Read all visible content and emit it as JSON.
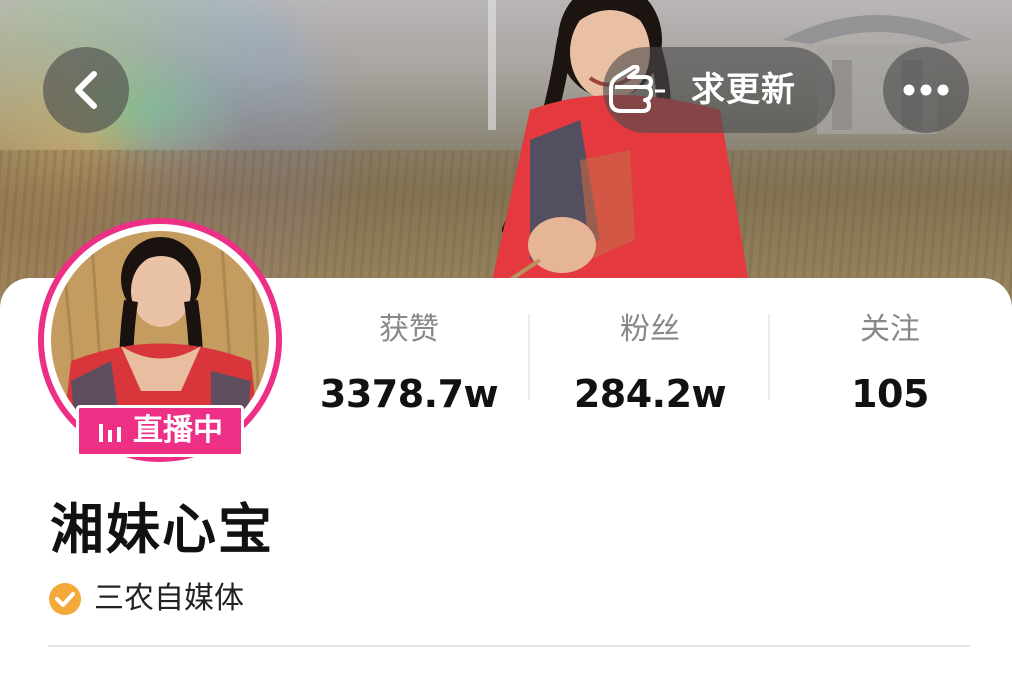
{
  "header": {
    "update_label": "求更新",
    "icons": [
      "chevron-left-icon",
      "pointing-hand-icon",
      "more-dots-icon"
    ]
  },
  "profile": {
    "live_label": "直播中",
    "name": "湘妹心宝",
    "verification": "三农自媒体"
  },
  "stats": [
    {
      "label": "获赞",
      "value": "3378.7w"
    },
    {
      "label": "粉丝",
      "value": "284.2w"
    },
    {
      "label": "关注",
      "value": "105"
    }
  ],
  "colors": {
    "accent_pink": "#ee2f86",
    "verify_badge": "#f4a93b",
    "text_primary": "#111111",
    "text_secondary": "#888888"
  }
}
